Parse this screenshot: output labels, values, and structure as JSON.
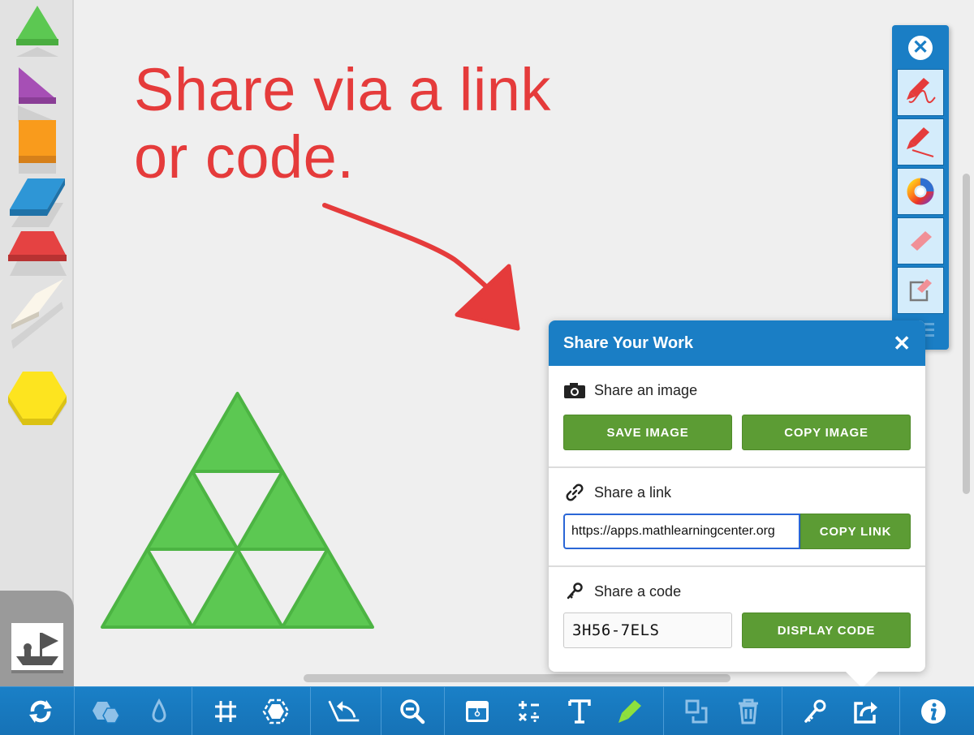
{
  "canvas": {
    "annotation_lines": [
      "Share via a link",
      "or code."
    ],
    "annotation_color": "#e53b3b",
    "pattern_block_color": "#5cc852"
  },
  "palette": {
    "shapes": [
      {
        "name": "triangle",
        "color": "#5cc852"
      },
      {
        "name": "right-triangle",
        "color": "#a64fb5"
      },
      {
        "name": "square",
        "color": "#f99b1c"
      },
      {
        "name": "blue-rhombus",
        "color": "#2e96d6"
      },
      {
        "name": "trapezoid",
        "color": "#e54242"
      },
      {
        "name": "thin-rhombus",
        "color": "#fbf6ea"
      },
      {
        "name": "hexagon",
        "color": "#fde41f"
      }
    ],
    "tray_icon": "boat-flag-icon"
  },
  "draw_tools": {
    "close_icon": "close-circle-icon",
    "buttons": [
      "freehand-pen-icon",
      "line-pen-icon",
      "color-wheel-icon",
      "eraser-icon",
      "edit-note-icon"
    ]
  },
  "share_dialog": {
    "title": "Share Your Work",
    "close_label": "✕",
    "image_section": {
      "label": "Share an image",
      "save_button": "SAVE IMAGE",
      "copy_button": "COPY IMAGE"
    },
    "link_section": {
      "label": "Share a link",
      "url_value": "https://apps.mathlearningcenter.org",
      "copy_button": "COPY LINK"
    },
    "code_section": {
      "label": "Share a code",
      "code_value": "3H56-7ELS",
      "display_button": "DISPLAY CODE"
    },
    "accent_color": "#1a7ec5",
    "button_color": "#5c9c34"
  },
  "toolbar": {
    "buttons": [
      "reset-icon",
      "shapes-icon",
      "fill-color-icon",
      "grid-icon",
      "outline-hexagon-icon",
      "rotate-icon",
      "zoom-out-icon",
      "hide-tray-icon",
      "math-symbols-icon",
      "text-icon",
      "highlighter-icon",
      "duplicate-icon",
      "trash-icon",
      "key-icon",
      "share-icon",
      "info-icon"
    ]
  }
}
